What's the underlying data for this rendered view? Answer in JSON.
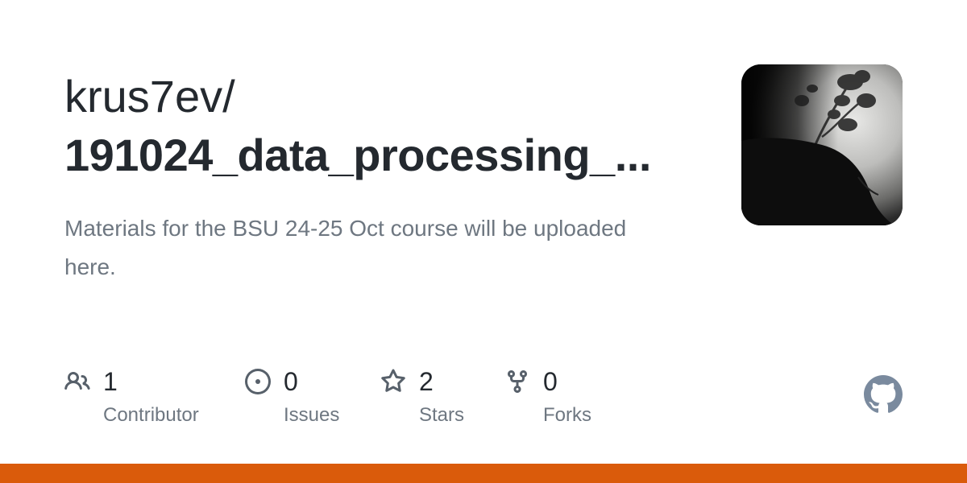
{
  "repo": {
    "owner": "krus7ev/",
    "name": "191024_data_processing_...",
    "description": "Materials for the BSU 24-25 Oct course will be uploaded here."
  },
  "avatar": {
    "icon": "user-avatar-photo"
  },
  "stats": {
    "contributors": {
      "value": "1",
      "label": "Contributor",
      "icon": "people-icon"
    },
    "issues": {
      "value": "0",
      "label": "Issues",
      "icon": "issue-opened-icon"
    },
    "stars": {
      "value": "2",
      "label": "Stars",
      "icon": "star-icon"
    },
    "forks": {
      "value": "0",
      "label": "Forks",
      "icon": "repo-forked-icon"
    }
  },
  "colors": {
    "text_primary": "#24292f",
    "text_secondary": "#6e7781",
    "icon": "#57606a",
    "github_mark": "#7a8a9e",
    "language_bar": "#da5b0b"
  }
}
